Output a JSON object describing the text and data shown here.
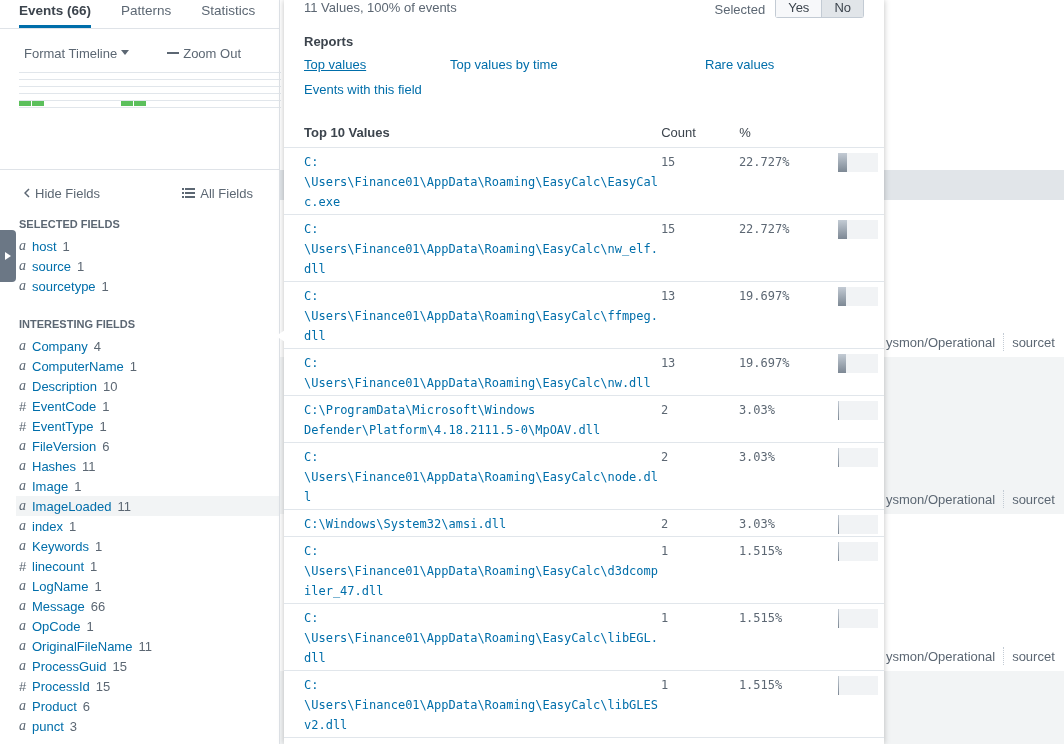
{
  "tabs": [
    {
      "label": "Events (66)",
      "selected": true
    },
    {
      "label": "Patterns",
      "selected": false
    },
    {
      "label": "Statistics",
      "selected": false
    }
  ],
  "timeline": {
    "format_button": "Format Timeline",
    "zoom_out_button": "Zoom Out"
  },
  "sidebar": {
    "hide_fields": "Hide Fields",
    "all_fields": "All Fields",
    "sections": [
      {
        "title": "SELECTED FIELDS",
        "fields": [
          {
            "type": "a",
            "name": "host",
            "count": "1",
            "selected": false
          },
          {
            "type": "a",
            "name": "source",
            "count": "1",
            "selected": false
          },
          {
            "type": "a",
            "name": "sourcetype",
            "count": "1",
            "selected": false
          }
        ]
      },
      {
        "title": "INTERESTING FIELDS",
        "fields": [
          {
            "type": "a",
            "name": "Company",
            "count": "4",
            "selected": false
          },
          {
            "type": "a",
            "name": "ComputerName",
            "count": "1",
            "selected": false
          },
          {
            "type": "a",
            "name": "Description",
            "count": "10",
            "selected": false
          },
          {
            "type": "#",
            "name": "EventCode",
            "count": "1",
            "selected": false
          },
          {
            "type": "#",
            "name": "EventType",
            "count": "1",
            "selected": false
          },
          {
            "type": "a",
            "name": "FileVersion",
            "count": "6",
            "selected": false
          },
          {
            "type": "a",
            "name": "Hashes",
            "count": "11",
            "selected": false
          },
          {
            "type": "a",
            "name": "Image",
            "count": "1",
            "selected": false
          },
          {
            "type": "a",
            "name": "ImageLoaded",
            "count": "11",
            "selected": true
          },
          {
            "type": "a",
            "name": "index",
            "count": "1",
            "selected": false
          },
          {
            "type": "a",
            "name": "Keywords",
            "count": "1",
            "selected": false
          },
          {
            "type": "#",
            "name": "linecount",
            "count": "1",
            "selected": false
          },
          {
            "type": "a",
            "name": "LogName",
            "count": "1",
            "selected": false
          },
          {
            "type": "a",
            "name": "Message",
            "count": "66",
            "selected": false
          },
          {
            "type": "a",
            "name": "OpCode",
            "count": "1",
            "selected": false
          },
          {
            "type": "a",
            "name": "OriginalFileName",
            "count": "11",
            "selected": false
          },
          {
            "type": "a",
            "name": "ProcessGuid",
            "count": "15",
            "selected": false
          },
          {
            "type": "#",
            "name": "ProcessId",
            "count": "15",
            "selected": false
          },
          {
            "type": "a",
            "name": "Product",
            "count": "6",
            "selected": false
          },
          {
            "type": "a",
            "name": "punct",
            "count": "3",
            "selected": false
          }
        ]
      }
    ]
  },
  "events": [
    {
      "source": "ysmon/Operational",
      "field": "sourcet",
      "shaded": false
    },
    {
      "source": "ysmon/Operational",
      "field": "sourcet",
      "shaded": true
    },
    {
      "source": "ysmon/Operational",
      "field": "sourcet",
      "shaded": false
    }
  ],
  "popup": {
    "summary": "11 Values, 100% of events",
    "selected_label": "Selected",
    "toggle": [
      {
        "label": "Yes",
        "selected": false
      },
      {
        "label": "No",
        "selected": true
      }
    ],
    "reports_title": "Reports",
    "reports": [
      {
        "label": "Top values",
        "hovered": true
      },
      {
        "label": "Top values by time",
        "hovered": false
      },
      {
        "label": "Rare values",
        "hovered": false
      },
      {
        "label": "Events with this field",
        "hovered": false
      }
    ],
    "table": {
      "columns": [
        "Top 10 Values",
        "Count",
        "%"
      ],
      "rows": [
        {
          "value": "C:\\Users\\Finance01\\AppData\\Roaming\\EasyCalc\\EasyCalc.exe",
          "count": "15",
          "percent": "22.727%",
          "level": 0.227
        },
        {
          "value": "C:\\Users\\Finance01\\AppData\\Roaming\\EasyCalc\\nw_elf.dll",
          "count": "15",
          "percent": "22.727%",
          "level": 0.227
        },
        {
          "value": "C:\\Users\\Finance01\\AppData\\Roaming\\EasyCalc\\ffmpeg.dll",
          "count": "13",
          "percent": "19.697%",
          "level": 0.197
        },
        {
          "value": "C:\\Users\\Finance01\\AppData\\Roaming\\EasyCalc\\nw.dll",
          "count": "13",
          "percent": "19.697%",
          "level": 0.197
        },
        {
          "value": "C:\\ProgramData\\Microsoft\\Windows Defender\\Platform\\4.18.2111.5-0\\MpOAV.dll",
          "count": "2",
          "percent": "3.03%",
          "level": 0.03
        },
        {
          "value": "C:\\Users\\Finance01\\AppData\\Roaming\\EasyCalc\\node.dll",
          "count": "2",
          "percent": "3.03%",
          "level": 0.03
        },
        {
          "value": "C:\\Windows\\System32\\amsi.dll",
          "count": "2",
          "percent": "3.03%",
          "level": 0.03
        },
        {
          "value": "C:\\Users\\Finance01\\AppData\\Roaming\\EasyCalc\\d3dcompiler_47.dll",
          "count": "1",
          "percent": "1.515%",
          "level": 0.015
        },
        {
          "value": "C:\\Users\\Finance01\\AppData\\Roaming\\EasyCalc\\libEGL.dll",
          "count": "1",
          "percent": "1.515%",
          "level": 0.015
        },
        {
          "value": "C:\\Users\\Finance01\\AppData\\Roaming\\EasyCalc\\libGLESv2.dll",
          "count": "1",
          "percent": "1.515%",
          "level": 0.015
        }
      ]
    }
  }
}
